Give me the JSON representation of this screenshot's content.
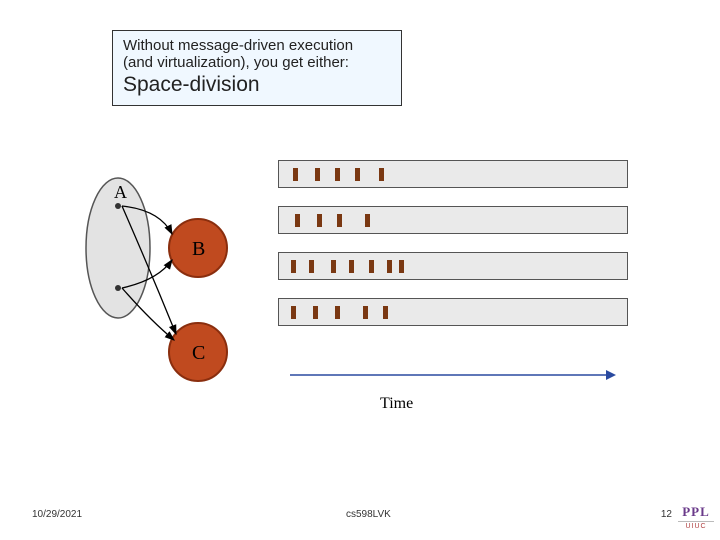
{
  "title": {
    "line1": "Without message-driven execution",
    "line2": "(and virtualization), you get either:",
    "main": "Space-division"
  },
  "nodes": {
    "a_label": "A",
    "b_label": "B",
    "c_label": "C"
  },
  "axis_label": "Time",
  "footer": {
    "date": "10/29/2021",
    "code": "cs598LVK",
    "page": "12",
    "org": "PPL",
    "inst": "UIUC"
  },
  "chart_data": {
    "type": "bar",
    "description": "Four horizontal processor timelines showing small busy-ticks (space-division scheduling)",
    "xlabel": "Time",
    "ylabel": "",
    "x_range": [
      0,
      350
    ],
    "rows": [
      {
        "ticks_x": [
          14,
          36,
          56,
          76,
          100
        ]
      },
      {
        "ticks_x": [
          16,
          38,
          58,
          86
        ]
      },
      {
        "ticks_x": [
          12,
          30,
          52,
          70,
          90,
          108,
          120
        ]
      },
      {
        "ticks_x": [
          12,
          34,
          56,
          84,
          104
        ]
      }
    ]
  }
}
